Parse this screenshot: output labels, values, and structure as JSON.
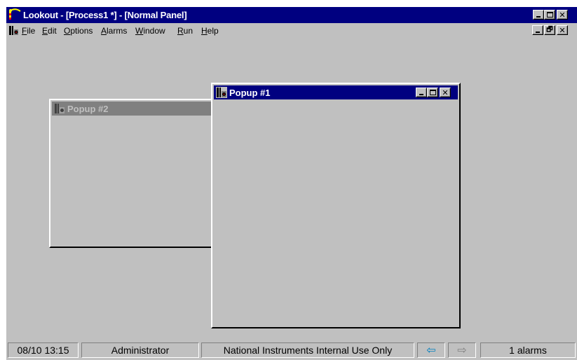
{
  "app": {
    "title": "Lookout - [Process1 *] - [Normal Panel]"
  },
  "menubar": {
    "items": [
      {
        "key": "F",
        "rest": "ile"
      },
      {
        "key": "E",
        "rest": "dit"
      },
      {
        "key": "O",
        "rest": "ptions"
      },
      {
        "key": "A",
        "rest": "larms"
      },
      {
        "key": "W",
        "rest": "indow"
      },
      {
        "key": "R",
        "rest": "un"
      },
      {
        "key": "H",
        "rest": "elp"
      }
    ]
  },
  "windows": {
    "popup2": {
      "title": "Popup #2",
      "state": "inactive"
    },
    "popup1": {
      "title": "Popup #1",
      "state": "active"
    }
  },
  "statusbar": {
    "datetime": "08/10 13:15",
    "user": "Administrator",
    "license": "National Instruments Internal Use Only",
    "back_icon": "arrow-left-icon",
    "forward_icon": "arrow-right-icon",
    "alarms": "1 alarms"
  },
  "colors": {
    "active_caption": "#000080",
    "inactive_caption": "#808080",
    "face": "#c0c0c0",
    "back_arrow": "#0080c0"
  }
}
